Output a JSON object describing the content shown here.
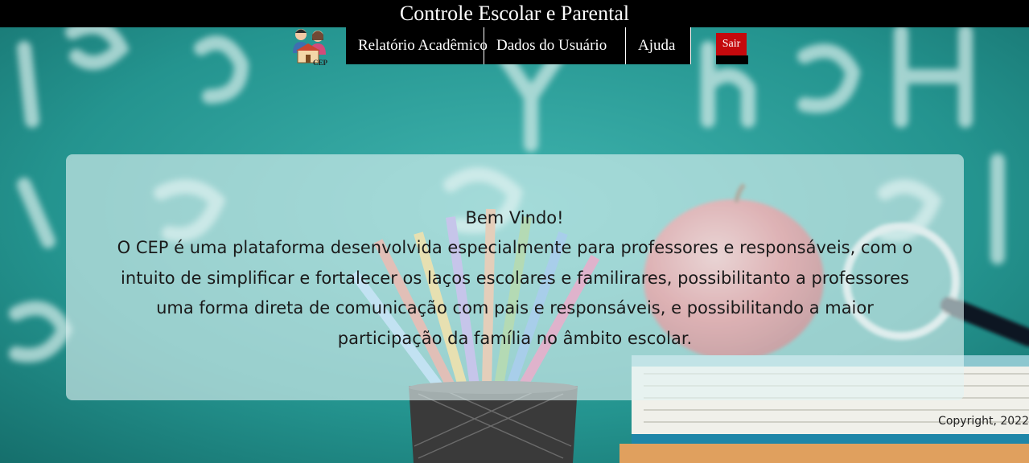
{
  "header": {
    "title": "Controle Escolar e Parental"
  },
  "logo": {
    "text": "CEP"
  },
  "nav": {
    "items": [
      {
        "label": "Relatório Acadêmico"
      },
      {
        "label": "Dados do Usuário"
      },
      {
        "label": "Ajuda"
      }
    ],
    "logout_label": "Sair"
  },
  "main": {
    "welcome_title": "Bem Vindo!",
    "welcome_text": "O CEP é uma plataforma desenvolvida especialmente para professores e responsáveis, com o intuito de simplificar e fortalecer os laços escolares e familirares, possibilitanto a professores uma forma direta de comunicação com pais e responsáveis, e possibilitando a maior participação da família no âmbito escolar."
  },
  "footer": {
    "copyright": "Copyright, 2022"
  },
  "colors": {
    "title_bar": "#000000",
    "nav_background": "#000000",
    "logout_button": "#c4090d",
    "board": "#2a9a97"
  }
}
